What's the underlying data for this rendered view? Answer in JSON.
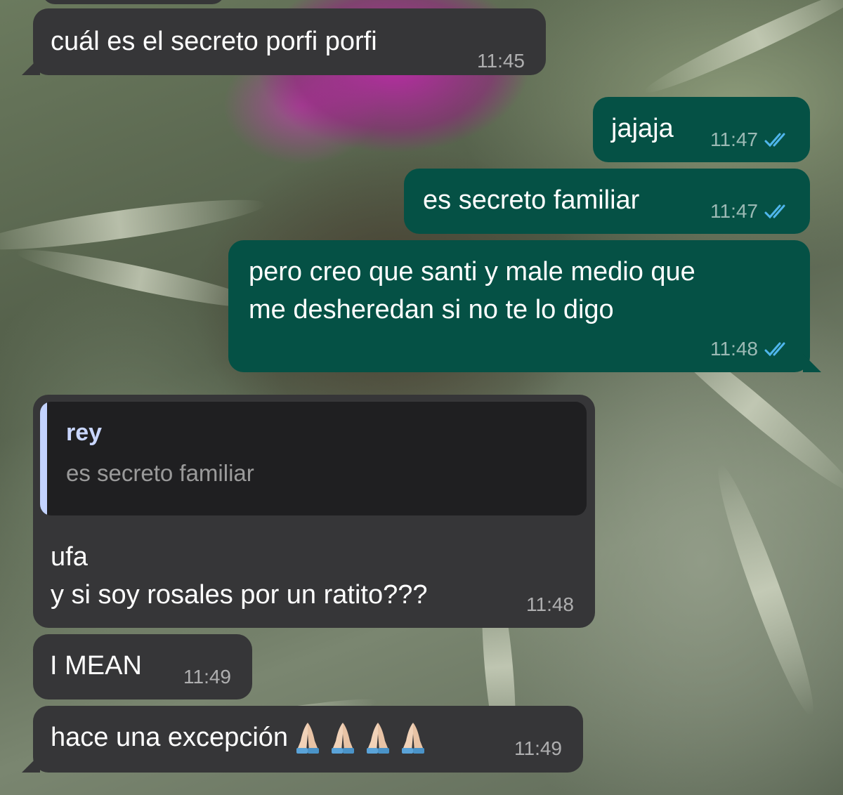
{
  "messages": [
    {
      "id": "m1",
      "direction": "incoming",
      "text": "cuál es el secreto porfi porfi",
      "time": "11:45"
    },
    {
      "id": "m2",
      "direction": "outgoing",
      "text": "jajaja",
      "time": "11:47",
      "status": "read"
    },
    {
      "id": "m3",
      "direction": "outgoing",
      "text": "es secreto familiar",
      "time": "11:47",
      "status": "read"
    },
    {
      "id": "m4",
      "direction": "outgoing",
      "lines": [
        "pero creo que santi y male medio que",
        "me desheredan si no te lo digo"
      ],
      "time": "11:48",
      "status": "read"
    },
    {
      "id": "m5",
      "direction": "incoming",
      "quote": {
        "author": "rey",
        "text": "es secreto familiar"
      },
      "lines": [
        "ufa",
        "y si soy rosales por un ratito???"
      ],
      "time": "11:48"
    },
    {
      "id": "m6",
      "direction": "incoming",
      "text": "I MEAN",
      "time": "11:49"
    },
    {
      "id": "m7",
      "direction": "incoming",
      "text": "hace una excepción",
      "emoji": [
        "folded-hands-icon",
        "folded-hands-icon",
        "folded-hands-icon",
        "folded-hands-icon"
      ],
      "time": "11:49"
    }
  ],
  "colors": {
    "incoming_bubble": "#363638",
    "outgoing_bubble": "#055145",
    "read_ticks": "#4fb6ec",
    "quote_bar": "#c3d3ff"
  }
}
